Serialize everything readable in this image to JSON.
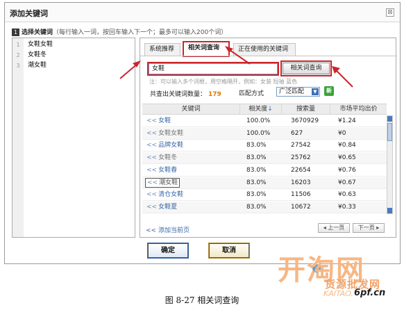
{
  "dialog": {
    "title": "添加关键词",
    "close_glyph": "⊠"
  },
  "section": {
    "number": "1",
    "label": "选择关键词",
    "hint": "（每行输入一词，按回车输入下一个；最多可以输入200个词）"
  },
  "keyword_editor": {
    "lines": [
      {
        "num": "1",
        "text": "女鞋女鞋"
      },
      {
        "num": "2",
        "text": "女鞋冬"
      },
      {
        "num": "3",
        "text": "潮女鞋"
      }
    ]
  },
  "tabs": [
    {
      "label": "系统推荐",
      "active": false
    },
    {
      "label": "相关词查询",
      "active": true
    },
    {
      "label": "正在使用的关键词",
      "active": false
    }
  ],
  "search": {
    "value": "女鞋",
    "button_label": "相关词查询",
    "tip": "注：可以输入多个词根，用空格隔开，例如：女装 短袖 蓝色"
  },
  "result": {
    "count_label": "共查出关键词数量：",
    "count_value": "179",
    "match_label": "匹配方式",
    "match_value": "广泛匹配",
    "new_badge": "新"
  },
  "table": {
    "headers": [
      "关键词",
      "相关度",
      "搜索量",
      "市场平均出价"
    ],
    "sort_indicator": "↓",
    "row_prefix": "<<",
    "rows": [
      {
        "keyword": "女鞋",
        "relevance": "100.0%",
        "volume": "3670929",
        "price": "¥1.24",
        "style": "link"
      },
      {
        "keyword": "女鞋女鞋",
        "relevance": "100.0%",
        "volume": "627",
        "price": "¥0",
        "style": "grey"
      },
      {
        "keyword": "品牌女鞋",
        "relevance": "83.0%",
        "volume": "27542",
        "price": "¥0.84",
        "style": "link"
      },
      {
        "keyword": "女鞋冬",
        "relevance": "83.0%",
        "volume": "25762",
        "price": "¥0.65",
        "style": "grey"
      },
      {
        "keyword": "女鞋春",
        "relevance": "83.0%",
        "volume": "22654",
        "price": "¥0.76",
        "style": "link"
      },
      {
        "keyword": "潮女鞋",
        "relevance": "83.0%",
        "volume": "16203",
        "price": "¥0.67",
        "style": "boxed"
      },
      {
        "keyword": "清仓女鞋",
        "relevance": "83.0%",
        "volume": "11506",
        "price": "¥0.63",
        "style": "link"
      },
      {
        "keyword": "女鞋夏",
        "relevance": "83.0%",
        "volume": "10672",
        "price": "¥0.33",
        "style": "link"
      }
    ]
  },
  "footer": {
    "add_page": "<< 添加当前页",
    "prev": "◂ 上一页",
    "next": "下一页 ▸"
  },
  "buttons": {
    "ok": "确定",
    "cancel": "取消"
  },
  "watermark": {
    "main": "开淘网",
    "sub": "货源批发网",
    "url_left": "KAITAO.",
    "url_right": "6pf.cn"
  },
  "caption": "图 8-27    相关词查询",
  "colors": {
    "highlight_red": "#c8262c",
    "link_blue": "#3a68a8",
    "count_orange": "#e07b00"
  }
}
